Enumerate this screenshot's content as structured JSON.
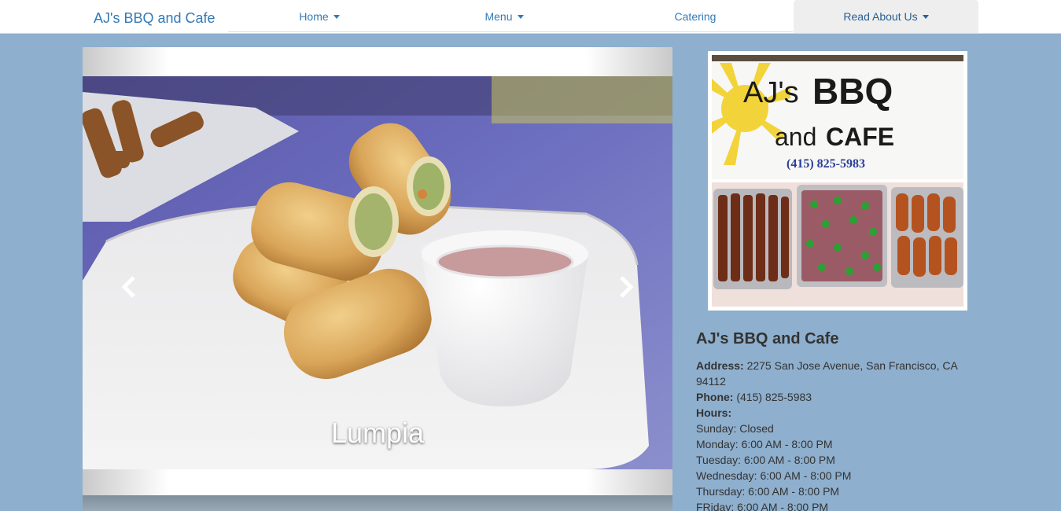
{
  "navbar": {
    "brand": "AJ's BBQ and Cafe",
    "items": [
      {
        "label": "Home",
        "dropdown": true
      },
      {
        "label": "Menu",
        "dropdown": true
      },
      {
        "label": "Catering",
        "dropdown": false
      },
      {
        "label": "Read About Us",
        "dropdown": true,
        "active": true
      }
    ]
  },
  "carousel": {
    "caption": "Lumpia",
    "prev_icon": "chevron-left-icon",
    "next_icon": "chevron-right-icon"
  },
  "logo": {
    "line1": "AJ's",
    "line2": "BBQ",
    "line3": "and",
    "line4": "CAFE",
    "phone": "(415) 825-5983"
  },
  "info": {
    "title": "AJ's BBQ and Cafe",
    "address_label": "Address:",
    "address": "2275 San Jose Avenue, San Francisco, CA 94112",
    "phone_label": "Phone:",
    "phone": "(415) 825-5983",
    "hours_label": "Hours:",
    "hours": [
      "Sunday: Closed",
      "Monday: 6:00 AM - 8:00 PM",
      "Tuesday: 6:00 AM - 8:00 PM",
      "Wednesday: 6:00 AM - 8:00 PM",
      "Thursday: 6:00 AM - 8:00 PM",
      "FRiday: 6:00 AM - 8:00 PM"
    ]
  },
  "colors": {
    "page_background": "#8eafcd",
    "link": "#337ab7",
    "active_nav_background": "#eeeeee",
    "text": "#333333"
  }
}
